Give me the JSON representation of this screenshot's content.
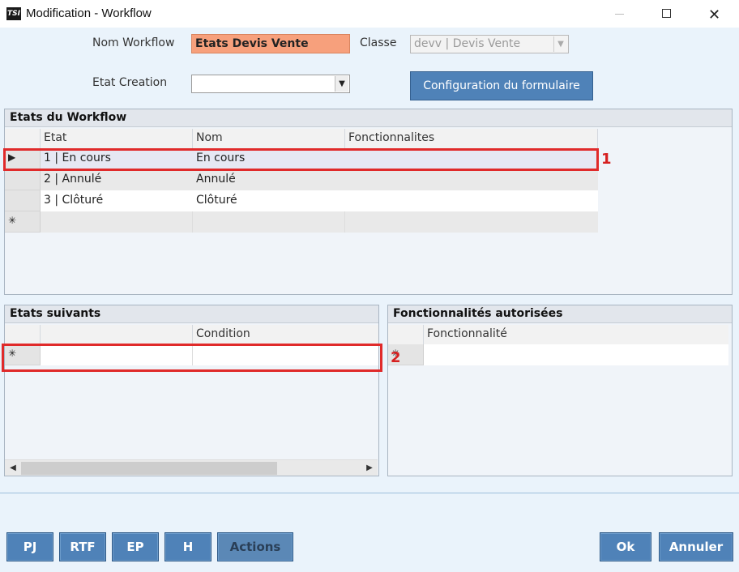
{
  "window": {
    "title": "Modification - Workflow",
    "app_icon_text": "TSI"
  },
  "form": {
    "nom_workflow_label": "Nom Workflow",
    "nom_workflow_value": "Etats Devis Vente",
    "classe_label": "Classe",
    "classe_value": "devv | Devis Vente",
    "etat_creation_label": "Etat Creation",
    "etat_creation_value": "",
    "config_button": "Configuration du formulaire"
  },
  "etats_workflow": {
    "title": "Etats du Workflow",
    "columns": [
      "Etat",
      "Nom",
      "Fonctionnalites"
    ],
    "rows": [
      {
        "marker": "▶",
        "etat": "1 | En cours",
        "nom": "En cours",
        "fonctionnalites": ""
      },
      {
        "marker": "",
        "etat": "2 | Annulé",
        "nom": "Annulé",
        "fonctionnalites": ""
      },
      {
        "marker": "",
        "etat": "3 | Clôturé",
        "nom": "Clôturé",
        "fonctionnalites": ""
      }
    ],
    "new_row_marker": "✳"
  },
  "etats_suivants": {
    "title": "Etats suivants",
    "columns": [
      "",
      "Condition"
    ],
    "new_row_marker": "✳"
  },
  "fonctionnalites": {
    "title": "Fonctionnalités autorisées",
    "columns": [
      "Fonctionnalité"
    ],
    "new_row_marker": "✳"
  },
  "annotations": {
    "label_1": "1",
    "label_2": "2",
    "color": "#e02a2a"
  },
  "buttons": {
    "pj": "PJ",
    "rtf": "RTF",
    "ep": "EP",
    "h": "H",
    "actions": "Actions",
    "ok": "Ok",
    "annuler": "Annuler"
  },
  "colors": {
    "accent": "#4f82b8",
    "highlight_field": "#f7a07c",
    "background": "#eaf3fb"
  }
}
